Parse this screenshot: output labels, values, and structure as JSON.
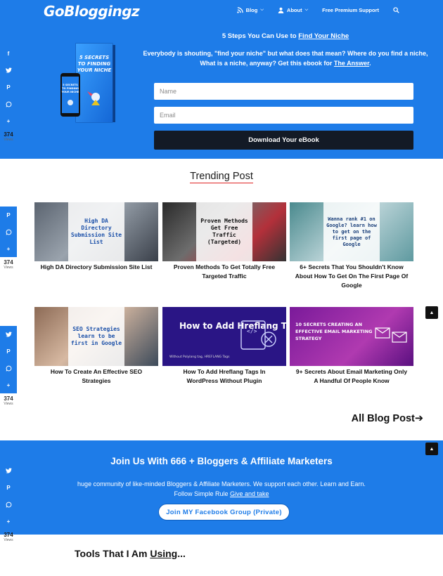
{
  "header": {
    "logo": "GoBloggingz",
    "nav": [
      {
        "label": "Blog",
        "icon": "rss-icon",
        "dropdown": true
      },
      {
        "label": "About",
        "icon": "user-icon",
        "dropdown": true
      },
      {
        "label": "Free Premium Support",
        "icon": "",
        "dropdown": false
      }
    ]
  },
  "hero": {
    "headline_pre": "5 Steps You Can Use to ",
    "headline_link": "Find Your Niche",
    "desc_pre": "Everybody is shouting, \"find your niche\" but what does that mean? Where do you find a niche, What is a niche, anyway?  Get this ebook for ",
    "desc_link": "The Answer",
    "desc_post": ".",
    "book_title": "5 SECRETS TO FINDING YOUR NICHE",
    "phone_text": "5 SECRETS TO FINDING YOUR NICHE",
    "name_placeholder": "Name",
    "email_placeholder": "Email",
    "button": "Download Your eBook"
  },
  "share": {
    "count": "374",
    "views": "Views",
    "colors": {
      "primary": "#1e7ce8"
    }
  },
  "trending": {
    "title": "Trending Post",
    "cards": [
      {
        "overlay": "High DA Directory Submission Site List",
        "title": "High DA Directory Submission Site List"
      },
      {
        "overlay": "Proven Methods Get Free Traffic (Targeted)",
        "title": "Proven Methods To Get Totally Free Targeted Traffic"
      },
      {
        "overlay": "Wanna rank #1 on Google? learn how to get on the first page of Google",
        "title": "6+ Secrets That You Shouldn't Know About How To Get On The First Page Of Google"
      },
      {
        "overlay": "SEO Strategies learn to be first in Google",
        "title": "How To Create An Effective SEO Strategies"
      },
      {
        "overlay": "How to Add Hreflang Tags in WordPress",
        "sub": "Without Polylang tag, HREFLANG Tags",
        "title": "How To Add Hreflang Tags In WordPress Without Plugin"
      },
      {
        "overlay": "10 SECRETS CREATING AN EFFECTIVE EMAIL MARKETING STRATEGY",
        "title": "9+ Secrets About Email Marketing Only A Handful Of People Know"
      }
    ],
    "all_posts": "All Blog Post➔"
  },
  "join": {
    "title": "Join Us With 666 +  Bloggers & Affiliate Marketers",
    "desc_line1": "huge community of like-minded Bloggers & Affiliate Marketers. We support each other. Learn and Earn.",
    "desc_line2_pre": "Follow Simple Rule ",
    "desc_line2_link": "Give and take",
    "button": "Join MY Facebook Group (Private)"
  },
  "tools": {
    "title_pre": "Tools That I Am ",
    "title_link": "Using",
    "title_post": "..."
  }
}
